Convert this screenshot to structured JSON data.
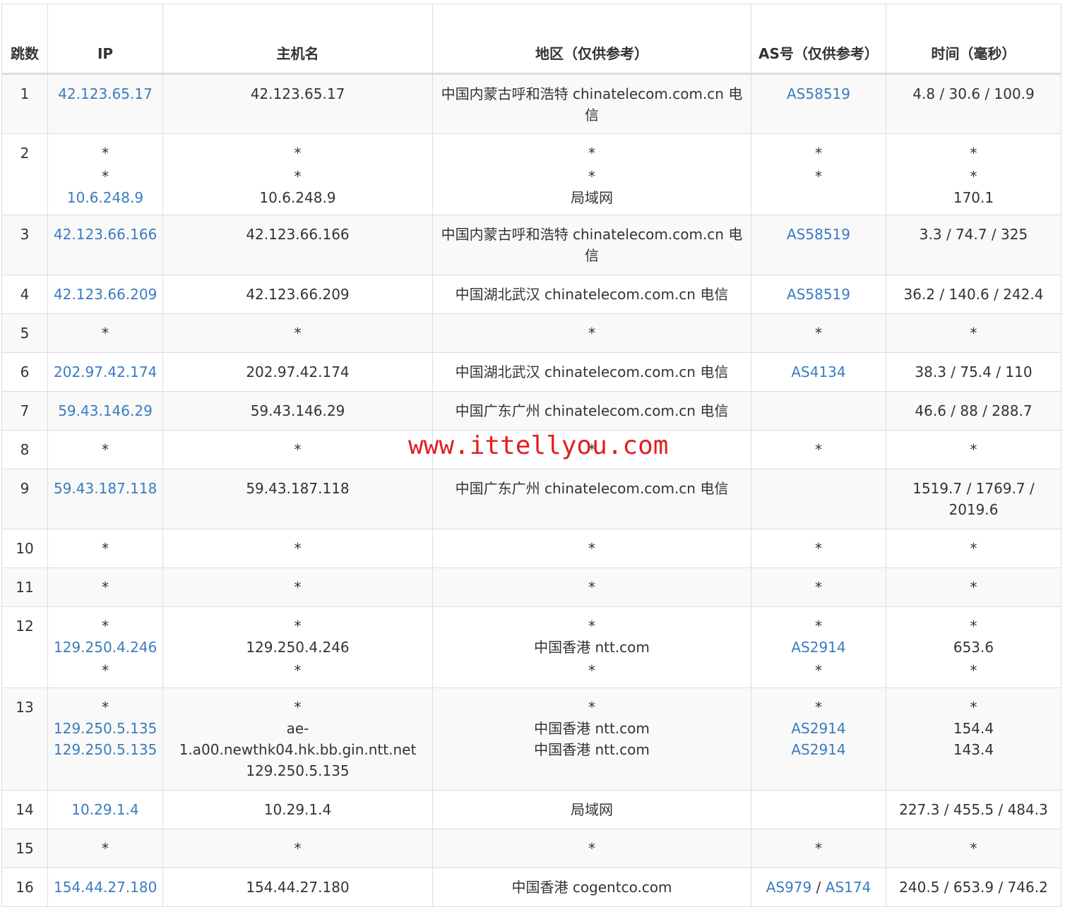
{
  "headers": [
    "跳数",
    "IP",
    "主机名",
    "地区（仅供参考）",
    "AS号（仅供参考）",
    "时间（毫秒）"
  ],
  "rows": [
    {
      "hop": "1",
      "ip": [
        "42.123.65.17"
      ],
      "host": [
        "42.123.65.17"
      ],
      "region": [
        "中国内蒙古呼和浩特 chinatelecom.com.cn 电信"
      ],
      "as": [
        [
          "AS58519"
        ]
      ],
      "time": [
        "4.8 / 30.6 / 100.9"
      ],
      "h": 85
    },
    {
      "hop": "2",
      "ip": [
        "*",
        "*",
        "10.6.248.9"
      ],
      "host": [
        "*",
        "*",
        "10.6.248.9"
      ],
      "region": [
        "*",
        "*",
        "局域网"
      ],
      "as": [
        [
          "*"
        ],
        [
          "*"
        ]
      ],
      "time": [
        "*",
        "*",
        "170.1"
      ],
      "h": 115
    },
    {
      "hop": "3",
      "ip": [
        "42.123.66.166"
      ],
      "host": [
        "42.123.66.166"
      ],
      "region": [
        "中国内蒙古呼和浩特 chinatelecom.com.cn 电信"
      ],
      "as": [
        [
          "AS58519"
        ]
      ],
      "time": [
        "3.3 / 74.7 / 325"
      ],
      "h": 85
    },
    {
      "hop": "4",
      "ip": [
        "42.123.66.209"
      ],
      "host": [
        "42.123.66.209"
      ],
      "region": [
        "中国湖北武汉 chinatelecom.com.cn 电信"
      ],
      "as": [
        [
          "AS58519"
        ]
      ],
      "time": [
        "36.2 / 140.6 / 242.4"
      ],
      "h": 55
    },
    {
      "hop": "5",
      "ip": [
        "*"
      ],
      "host": [
        "*"
      ],
      "region": [
        "*"
      ],
      "as": [
        [
          "*"
        ]
      ],
      "time": [
        "*"
      ],
      "h": 55
    },
    {
      "hop": "6",
      "ip": [
        "202.97.42.174"
      ],
      "host": [
        "202.97.42.174"
      ],
      "region": [
        "中国湖北武汉 chinatelecom.com.cn 电信"
      ],
      "as": [
        [
          "AS4134"
        ]
      ],
      "time": [
        "38.3 / 75.4 / 110"
      ],
      "h": 55
    },
    {
      "hop": "7",
      "ip": [
        "59.43.146.29"
      ],
      "host": [
        "59.43.146.29"
      ],
      "region": [
        "中国广东广州 chinatelecom.com.cn 电信"
      ],
      "as": [],
      "time": [
        "46.6 / 88 / 288.7"
      ],
      "h": 55
    },
    {
      "hop": "8",
      "ip": [
        "*"
      ],
      "host": [
        "*"
      ],
      "region": [
        "*"
      ],
      "as": [
        [
          "*"
        ]
      ],
      "time": [
        "*"
      ],
      "h": 55
    },
    {
      "hop": "9",
      "ip": [
        "59.43.187.118"
      ],
      "host": [
        "59.43.187.118"
      ],
      "region": [
        "中国广东广州 chinatelecom.com.cn 电信"
      ],
      "as": [],
      "time": [
        "1519.7 / 1769.7 / 2019.6"
      ],
      "h": 85
    },
    {
      "hop": "10",
      "ip": [
        "*"
      ],
      "host": [
        "*"
      ],
      "region": [
        "*"
      ],
      "as": [
        [
          "*"
        ]
      ],
      "time": [
        "*"
      ],
      "h": 55
    },
    {
      "hop": "11",
      "ip": [
        "*"
      ],
      "host": [
        "*"
      ],
      "region": [
        "*"
      ],
      "as": [
        [
          "*"
        ]
      ],
      "time": [
        "*"
      ],
      "h": 55
    },
    {
      "hop": "12",
      "ip": [
        "*",
        "129.250.4.246",
        "*"
      ],
      "host": [
        "*",
        "129.250.4.246",
        "*"
      ],
      "region": [
        "*",
        "中国香港 ntt.com",
        "*"
      ],
      "as": [
        [
          "*"
        ],
        [
          "AS2914"
        ],
        [
          "*"
        ]
      ],
      "time": [
        "*",
        "653.6",
        "*"
      ],
      "h": 115
    },
    {
      "hop": "13",
      "ip": [
        "*",
        "129.250.5.135",
        "129.250.5.135"
      ],
      "host": [
        "*",
        "ae-1.a00.newthk04.hk.bb.gin.ntt.net 129.250.5.135"
      ],
      "region": [
        "*",
        "中国香港 ntt.com",
        "中国香港 ntt.com"
      ],
      "as": [
        [
          "*"
        ],
        [
          "AS2914"
        ],
        [
          "AS2914"
        ]
      ],
      "time": [
        "*",
        "154.4",
        "143.4"
      ],
      "h": 145
    },
    {
      "hop": "14",
      "ip": [
        "10.29.1.4"
      ],
      "host": [
        "10.29.1.4"
      ],
      "region": [
        "局域网"
      ],
      "as": [],
      "time": [
        "227.3 / 455.5 / 484.3"
      ],
      "h": 55
    },
    {
      "hop": "15",
      "ip": [
        "*"
      ],
      "host": [
        "*"
      ],
      "region": [
        "*"
      ],
      "as": [
        [
          "*"
        ]
      ],
      "time": [
        "*"
      ],
      "h": 55
    },
    {
      "hop": "16",
      "ip": [
        "154.44.27.180"
      ],
      "host": [
        "154.44.27.180"
      ],
      "region": [
        "中国香港 cogentco.com"
      ],
      "as": [
        [
          "AS979",
          "AS174"
        ]
      ],
      "time": [
        "240.5 / 653.9 / 746.2"
      ],
      "h": 55
    }
  ],
  "watermark": "www.ittellyou.com",
  "colors": {
    "link": "#3b7bbf",
    "text": "#333333",
    "border": "#dddddd",
    "stripe": "#f9f9f9",
    "watermark": "#e02020"
  }
}
